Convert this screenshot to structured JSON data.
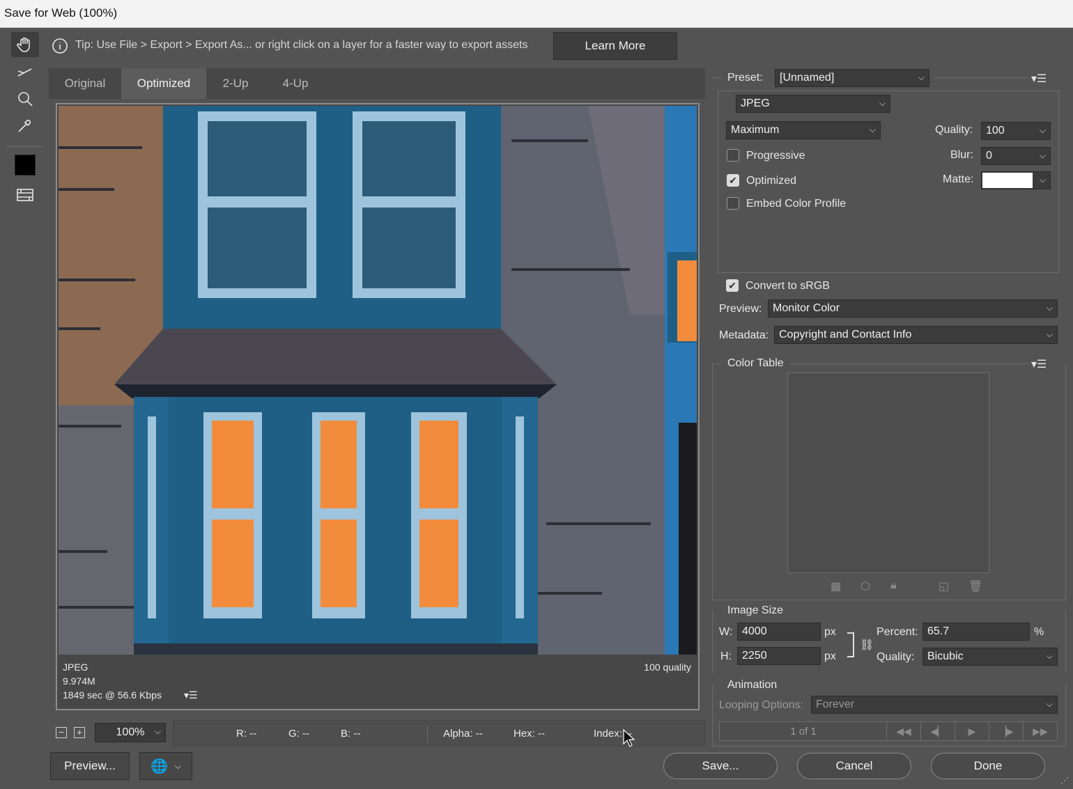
{
  "window": {
    "title": "Save for Web (100%)"
  },
  "tip": {
    "text": "Tip: Use File > Export > Export As...  or right click on a layer for a faster way to export assets",
    "learn_more": "Learn More"
  },
  "tabs": [
    {
      "label": "Original"
    },
    {
      "label": "Optimized"
    },
    {
      "label": "2-Up"
    },
    {
      "label": "4-Up"
    }
  ],
  "image_info": {
    "format": "JPEG",
    "size": "9.974M",
    "time": "1849 sec @ 56.6 Kbps",
    "quality": "100 quality"
  },
  "status": {
    "zoom": "100%",
    "r": "R: --",
    "g": "G: --",
    "b": "B: --",
    "alpha": "Alpha: --",
    "hex": "Hex: --",
    "index": "Index: --"
  },
  "buttons": {
    "preview": "Preview...",
    "save": "Save...",
    "cancel": "Cancel",
    "done": "Done"
  },
  "settings": {
    "preset_label": "Preset:",
    "preset": "[Unnamed]",
    "format": "JPEG",
    "compression": "Maximum",
    "quality_label": "Quality:",
    "quality": "100",
    "blur_label": "Blur:",
    "blur": "0",
    "matte_label": "Matte:",
    "progressive": "Progressive",
    "progressive_checked": false,
    "optimized": "Optimized",
    "optimized_checked": true,
    "embed_profile": "Embed Color Profile",
    "embed_checked": false,
    "convert_srgb": "Convert to sRGB",
    "convert_checked": true,
    "preview_label": "Preview:",
    "preview": "Monitor Color",
    "metadata_label": "Metadata:",
    "metadata": "Copyright and Contact Info"
  },
  "color_table": {
    "title": "Color Table"
  },
  "image_size": {
    "title": "Image Size",
    "w_label": "W:",
    "w": "4000",
    "h_label": "H:",
    "h": "2250",
    "unit": "px",
    "percent_label": "Percent:",
    "percent": "65.7",
    "percent_unit": "%",
    "quality_label": "Quality:",
    "quality": "Bicubic"
  },
  "animation": {
    "title": "Animation",
    "looping_label": "Looping Options:",
    "looping": "Forever",
    "frame": "1 of 1"
  },
  "colors": {
    "panel": "#535353",
    "field": "#3b3b3b",
    "facade": "#1f5f86",
    "window_glow": "#f28c3c",
    "frame": "#9ec4dd"
  }
}
